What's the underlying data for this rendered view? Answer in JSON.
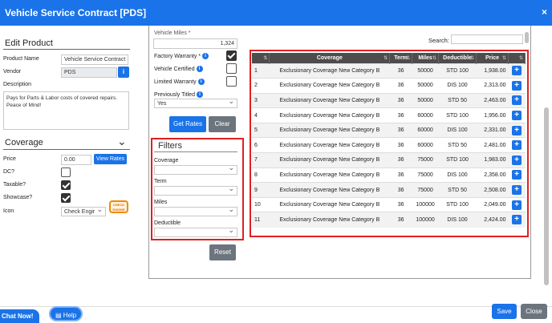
{
  "title": "Vehicle Service Contract [PDS]",
  "close_glyph": "×",
  "left": {
    "edit_header": "Edit Product",
    "product_name_label": "Product Name",
    "product_name_value": "Vehicle Service Contract",
    "vendor_label": "Vendor",
    "vendor_value": "PDS",
    "vendor_info_glyph": "i",
    "description_label": "Description",
    "description_value": "Pays for Parts & Labor costs of covered repairs. Peace of Mind!",
    "coverage_header": "Coverage",
    "coverage_chevron": "⌄",
    "price_label": "Price",
    "price_value": "0.00",
    "view_rates": "View Rates",
    "dc_label": "DC?",
    "taxable_label": "Taxable?",
    "showcase_label": "Showcase?",
    "icon_label": "Icon",
    "icon_value": "Check Engir",
    "check_engine_badge": "CHECK ENGINE"
  },
  "middle": {
    "vehicle_miles_label": "Vehicle Miles *",
    "vehicle_miles_value": "1,324",
    "factory_warranty_label": "Factory Warranty *",
    "vehicle_certified_label": "Vehicle Certified",
    "limited_warranty_label": "Limited Warranty",
    "previously_titled_label": "Previously Titled",
    "previously_titled_value": "Yes",
    "get_rates": "Get Rates",
    "clear": "Clear",
    "filters_header": "Filters",
    "filter_coverage": "Coverage",
    "filter_term": "Term",
    "filter_miles": "Miles",
    "filter_deductible": "Deductible",
    "reset": "Reset"
  },
  "table": {
    "search_label": "Search:",
    "columns": [
      "",
      "Coverage",
      "Term",
      "Miles",
      "Deductible",
      "Price",
      ""
    ],
    "rows": [
      [
        "1",
        "Exclusionary Coverage New Category B",
        "36",
        "50000",
        "STD 100",
        "1,938.00"
      ],
      [
        "2",
        "Exclusionary Coverage New Category B",
        "36",
        "50000",
        "DIS 100",
        "2,313.00"
      ],
      [
        "3",
        "Exclusionary Coverage New Category B",
        "36",
        "50000",
        "STD 50",
        "2,463.00"
      ],
      [
        "4",
        "Exclusionary Coverage New Category B",
        "36",
        "60000",
        "STD 100",
        "1,956.00"
      ],
      [
        "5",
        "Exclusionary Coverage New Category B",
        "36",
        "60000",
        "DIS 100",
        "2,331.00"
      ],
      [
        "6",
        "Exclusionary Coverage New Category B",
        "36",
        "60000",
        "STD 50",
        "2,481.00"
      ],
      [
        "7",
        "Exclusionary Coverage New Category B",
        "36",
        "75000",
        "STD 100",
        "1,983.00"
      ],
      [
        "8",
        "Exclusionary Coverage New Category B",
        "36",
        "75000",
        "DIS 100",
        "2,358.00"
      ],
      [
        "9",
        "Exclusionary Coverage New Category B",
        "36",
        "75000",
        "STD 50",
        "2,508.00"
      ],
      [
        "10",
        "Exclusionary Coverage New Category B",
        "36",
        "100000",
        "STD 100",
        "2,049.00"
      ],
      [
        "11",
        "Exclusionary Coverage New Category B",
        "36",
        "100000",
        "DIS 100",
        "2,424.00"
      ]
    ],
    "add_glyph": "+"
  },
  "footer": {
    "chat_now": "Chat Now!",
    "help": "Help",
    "save": "Save",
    "close": "Close"
  },
  "colors": {
    "accent": "#1a73e8",
    "highlight": "#e02020",
    "header_dark": "#4d4d4d"
  }
}
